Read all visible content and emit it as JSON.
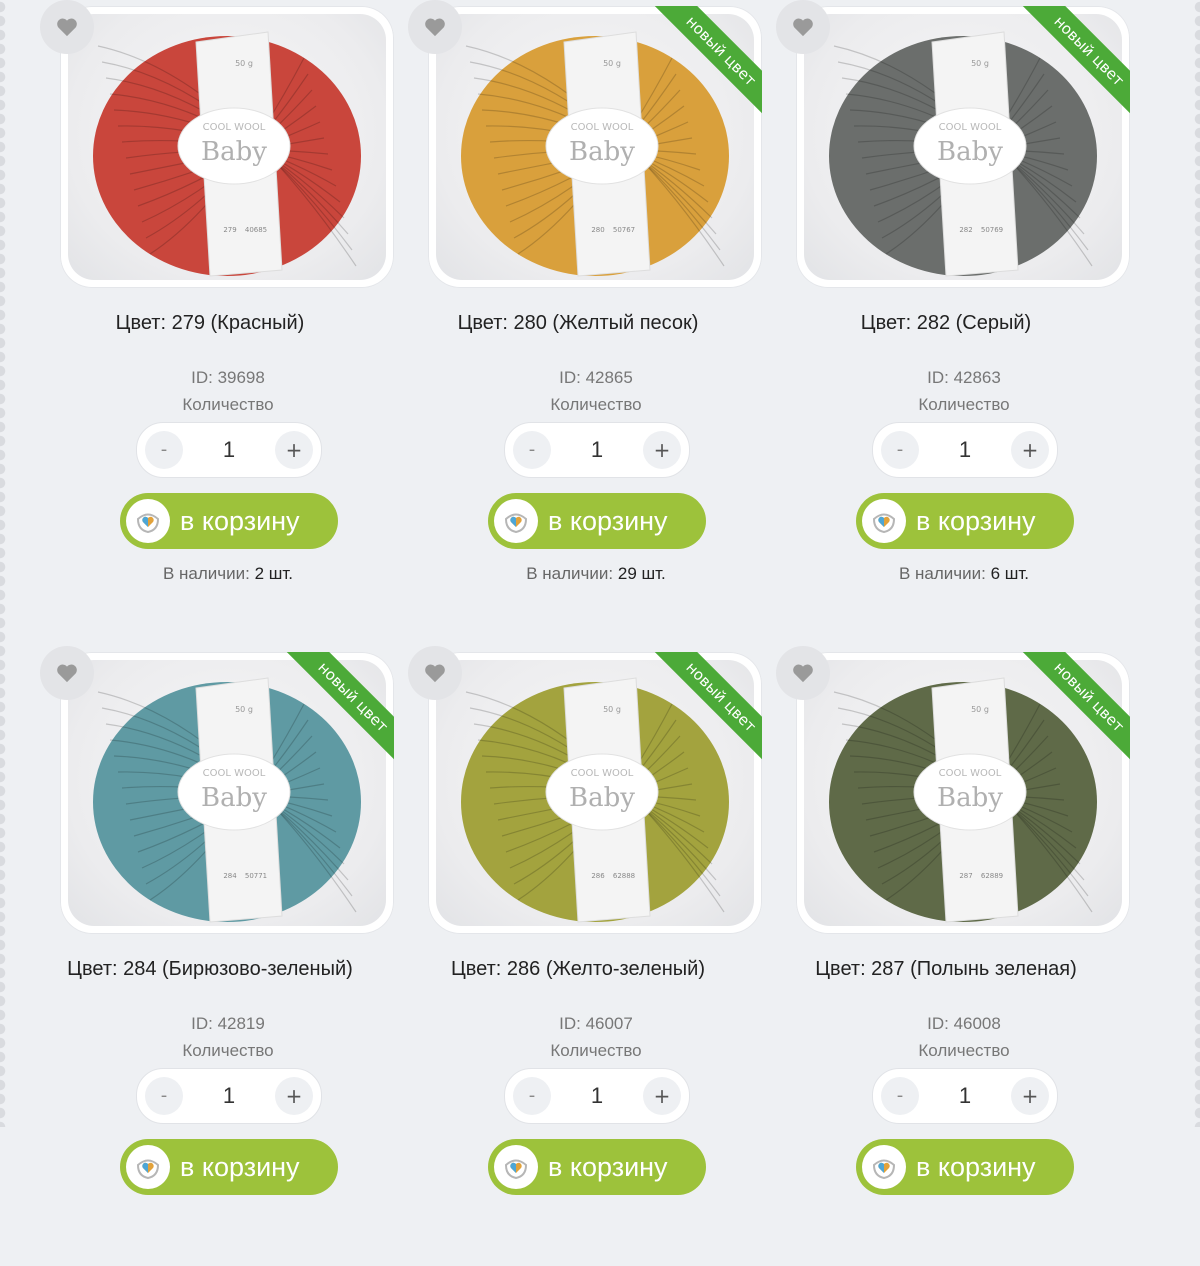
{
  "labels": {
    "quantity": "Количество",
    "cart": "в корзину",
    "in_stock": "В наличии:",
    "new_color": "новый цвет",
    "yarn_brand": "COOL WOOL",
    "yarn_name": "Baby",
    "yarn_weight": "50 g",
    "favorite_icon": "heart-icon",
    "cart_icon": "basket-heart-icon"
  },
  "colors": {
    "button_green": "#9dc23b",
    "ribbon_green": "#4caa38"
  },
  "products": [
    {
      "title": "Цвет: 279 (Красный)",
      "id": "ID: 39698",
      "qty": "1",
      "minus": "-",
      "plus": "+",
      "stock": "2 шт.",
      "is_new": false,
      "yarn_color": "#c9463c",
      "yarn_num": "279",
      "lot": "40685"
    },
    {
      "title": "Цвет: 280 (Желтый песок)",
      "id": "ID: 42865",
      "qty": "1",
      "minus": "-",
      "plus": "+",
      "stock": "29 шт.",
      "is_new": true,
      "yarn_color": "#d9a03c",
      "yarn_num": "280",
      "lot": "50767"
    },
    {
      "title": "Цвет: 282 (Серый)",
      "id": "ID: 42863",
      "qty": "1",
      "minus": "-",
      "plus": "+",
      "stock": "6 шт.",
      "is_new": true,
      "yarn_color": "#6b6e6c",
      "yarn_num": "282",
      "lot": "50769"
    },
    {
      "title": "Цвет: 284 (Бирюзово-зеленый)",
      "id": "ID: 42819",
      "qty": "1",
      "minus": "-",
      "plus": "+",
      "stock": "",
      "is_new": true,
      "yarn_color": "#5f9aa3",
      "yarn_num": "284",
      "lot": "50771"
    },
    {
      "title": "Цвет: 286 (Желто-зеленый)",
      "id": "ID: 46007",
      "qty": "1",
      "minus": "-",
      "plus": "+",
      "stock": "",
      "is_new": true,
      "yarn_color": "#a3a33e",
      "yarn_num": "286",
      "lot": "62888"
    },
    {
      "title": "Цвет: 287 (Полынь зеленая)",
      "id": "ID: 46008",
      "qty": "1",
      "minus": "-",
      "plus": "+",
      "stock": "",
      "is_new": true,
      "yarn_color": "#5f6a48",
      "yarn_num": "287",
      "lot": "62889"
    }
  ]
}
